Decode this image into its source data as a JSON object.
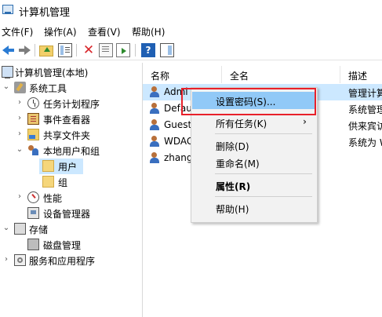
{
  "window": {
    "title": "计算机管理"
  },
  "menu": [
    "文件(F)",
    "操作(A)",
    "查看(V)",
    "帮助(H)"
  ],
  "toolbar": [
    "back-arrow",
    "forward-arrow",
    "up-folder",
    "show-tree",
    "delete",
    "properties",
    "export-list",
    "help",
    "action-pane"
  ],
  "tree": {
    "root": "计算机管理(本地)",
    "system_tools": "系统工具",
    "task_scheduler": "任务计划程序",
    "event_viewer": "事件查看器",
    "shared_folders": "共享文件夹",
    "local_users_groups": "本地用户和组",
    "users": "用户",
    "groups": "组",
    "performance": "性能",
    "device_manager": "设备管理器",
    "storage": "存储",
    "disk_management": "磁盘管理",
    "services_apps": "服务和应用程序"
  },
  "columns": {
    "name": "名称",
    "fullname": "全名",
    "description": "描述"
  },
  "rows": [
    {
      "name": "Admi",
      "fullname": "",
      "description": "管理计算"
    },
    {
      "name": "Defau",
      "fullname": "",
      "description": "系统管理"
    },
    {
      "name": "Guest",
      "fullname": "",
      "description": "供来宾访"
    },
    {
      "name": "WDAG",
      "fullname": "",
      "description": "系统为 W"
    },
    {
      "name": "zhang",
      "fullname": "",
      "description": ""
    }
  ],
  "context_menu": {
    "set_password": "设置密码(S)...",
    "all_tasks": "所有任务(K)",
    "submenu_arrow": "›",
    "delete": "删除(D)",
    "rename": "重命名(M)",
    "properties": "属性(R)",
    "help": "帮助(H)"
  },
  "colors": {
    "selection": "#cce8ff",
    "menu_hover": "#91c9f7",
    "highlight_box": "#e8202a"
  }
}
